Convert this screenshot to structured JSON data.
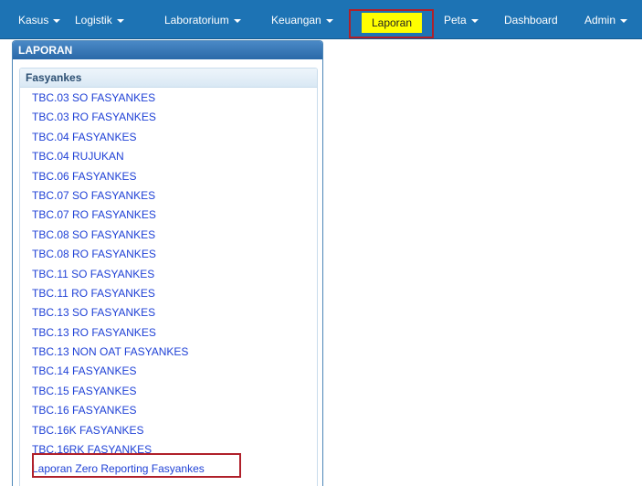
{
  "nav": {
    "items": [
      {
        "label": "Kasus",
        "dropdown": true
      },
      {
        "label": "Logistik",
        "dropdown": true
      },
      {
        "label": "Laboratorium",
        "dropdown": true
      },
      {
        "label": "Keuangan",
        "dropdown": true
      },
      {
        "label": "Laporan",
        "dropdown": false,
        "active": true
      },
      {
        "label": "Peta",
        "dropdown": true
      },
      {
        "label": "Dashboard",
        "dropdown": false
      },
      {
        "label": "Admin",
        "dropdown": true
      }
    ]
  },
  "panel": {
    "title": "LAPORAN",
    "group_title": "Fasyankes",
    "reports": [
      "TBC.03 SO FASYANKES",
      "TBC.03 RO FASYANKES",
      "TBC.04 FASYANKES",
      "TBC.04 RUJUKAN",
      "TBC.06 FASYANKES",
      "TBC.07 SO FASYANKES",
      "TBC.07 RO FASYANKES",
      "TBC.08 SO FASYANKES",
      "TBC.08 RO FASYANKES",
      "TBC.11 SO FASYANKES",
      "TBC.11 RO FASYANKES",
      "TBC.13 SO FASYANKES",
      "TBC.13 RO FASYANKES",
      "TBC.13 NON OAT FASYANKES",
      "TBC.14 FASYANKES",
      "TBC.15 FASYANKES",
      "TBC.16 FASYANKES",
      "TBC.16K FASYANKES",
      "TBC.16RK FASYANKES",
      "Laporan Zero Reporting Fasyankes"
    ]
  },
  "colors": {
    "navbar": "#1d73b4",
    "active_highlight": "#ffff00",
    "annotation_box": "#b0202a",
    "link": "#1f41d6"
  }
}
